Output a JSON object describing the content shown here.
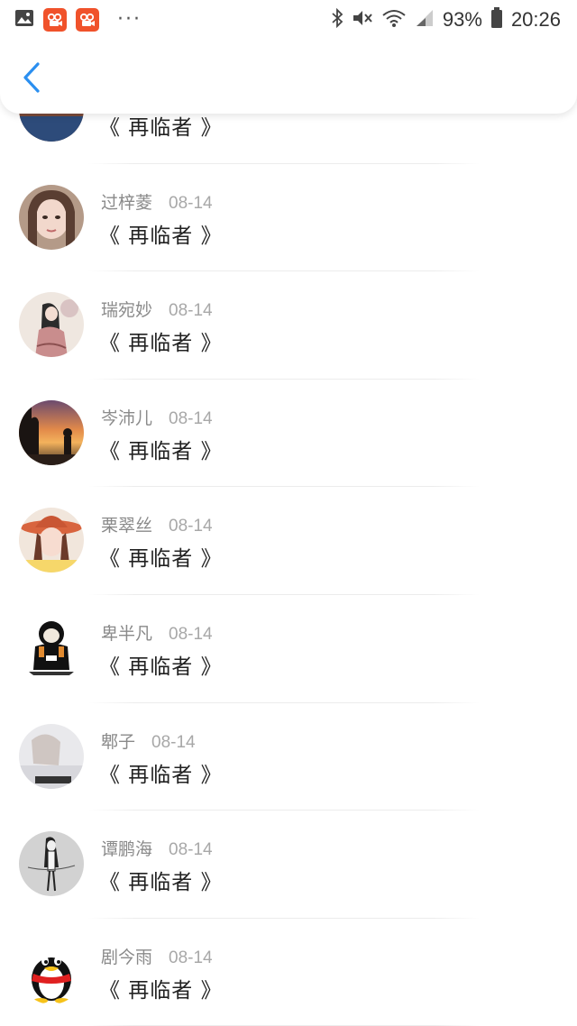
{
  "status_bar": {
    "icons": [
      "image-icon",
      "kuaishou-app-icon",
      "kuaishou-app-icon",
      "more-notifications-icon",
      "bluetooth-icon",
      "mute-icon",
      "wifi-icon",
      "signal-icon",
      "battery-icon"
    ],
    "dots": "···",
    "battery": "93%",
    "time": "20:26",
    "accent": "#f0522b"
  },
  "header": {
    "back_icon": "chevron-left-icon",
    "accent": "#2b8ff0"
  },
  "items": [
    {
      "name": "",
      "date": "",
      "title": "《 再临者 》",
      "avatar": "partial"
    },
    {
      "name": "过梓菱",
      "date": "08-14",
      "title": "《 再临者 》",
      "avatar": "girl-portrait"
    },
    {
      "name": "瑞宛妙",
      "date": "08-14",
      "title": "《 再临者 》",
      "avatar": "illustration-girl"
    },
    {
      "name": "岑沛儿",
      "date": "08-14",
      "title": "《 再临者 》",
      "avatar": "sunset-silhouette"
    },
    {
      "name": "栗翠丝",
      "date": "08-14",
      "title": "《 再临者 》",
      "avatar": "girl-hat"
    },
    {
      "name": "卑半凡",
      "date": "08-14",
      "title": "《 再临者 》",
      "avatar": "panda-meme"
    },
    {
      "name": "郫子",
      "date": "08-14",
      "title": "《 再临者 》",
      "avatar": "light-photo"
    },
    {
      "name": "谭鹏海",
      "date": "08-14",
      "title": "《 再临者 》",
      "avatar": "sketch-girl"
    },
    {
      "name": "剧今雨",
      "date": "08-14",
      "title": "《 再临者 》",
      "avatar": "qq-penguin"
    }
  ]
}
